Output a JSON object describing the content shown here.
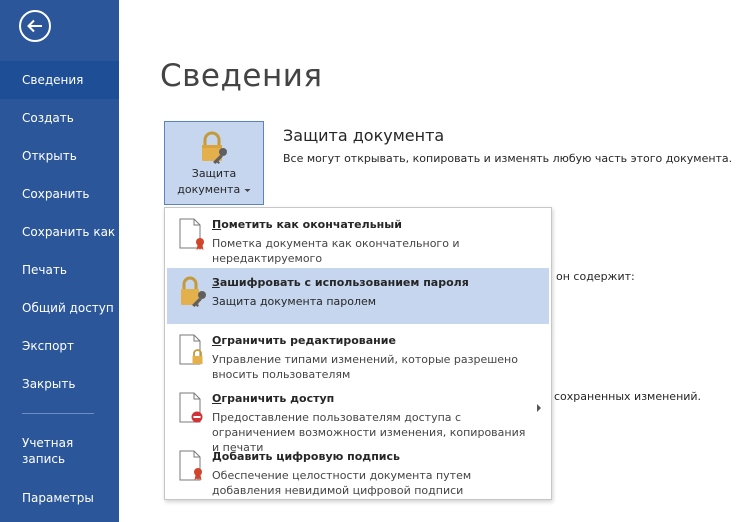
{
  "sidebar": {
    "items": [
      {
        "label": "Сведения",
        "active": true
      },
      {
        "label": "Создать"
      },
      {
        "label": "Открыть"
      },
      {
        "label": "Сохранить"
      },
      {
        "label": "Сохранить как"
      },
      {
        "label": "Печать"
      },
      {
        "label": "Общий доступ"
      },
      {
        "label": "Экспорт"
      },
      {
        "label": "Закрыть"
      }
    ],
    "account": {
      "line1": "Учетная",
      "line2": "запись"
    },
    "options": "Параметры",
    "colors": {
      "background": "#2b579a",
      "active": "#1e4e96"
    }
  },
  "main": {
    "title": "Сведения",
    "protect_button": {
      "line1": "Защита",
      "line2": "документа"
    },
    "section_title": "Защита документа",
    "section_desc": "Все могут открывать, копировать и изменять любую часть этого документа.",
    "partial_text_1": "он содержит:",
    "partial_text_2": "сохраненных изменений."
  },
  "menu": {
    "items": [
      {
        "accel": "П",
        "rest": "ометить как окончательный",
        "desc": "Пометка документа как окончательного и нередактируемого",
        "icon": "document-ribbon-icon"
      },
      {
        "accel": "З",
        "rest": "ашифровать с использованием пароля",
        "desc": "Защита документа паролем",
        "icon": "lock-key-icon",
        "highlighted": true
      },
      {
        "accel": "О",
        "rest": "граничить редактирование",
        "desc": "Управление типами изменений, которые разрешено вносить пользователям",
        "icon": "document-lock-icon"
      },
      {
        "accel": "О",
        "rest": "граничить доступ",
        "desc": "Предоставление пользователям доступа с ограничением возможности изменения, копирования и печати",
        "icon": "document-restrict-icon",
        "has_submenu": true
      },
      {
        "accel": "Д",
        "rest": "обавить цифровую подпись",
        "desc": "Обеспечение целостности документа путем добавления невидимой цифровой подписи",
        "icon": "document-signature-icon"
      }
    ],
    "highlight_color": "#c5d6ee"
  }
}
